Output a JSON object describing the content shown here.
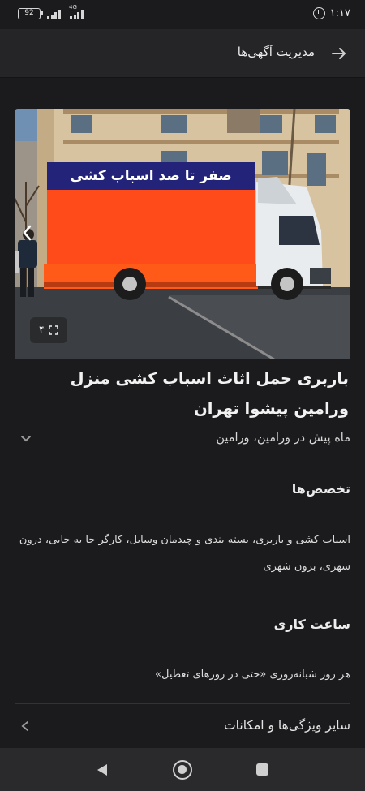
{
  "status_bar": {
    "battery": "92",
    "network": "4G",
    "time": "۱:۱۷",
    "icons": [
      "battery-icon",
      "signal-icon",
      "alarm-icon"
    ]
  },
  "header": {
    "title": "مدیریت آگهی‌ها",
    "back_icon": "arrow-right-icon"
  },
  "listing": {
    "image": {
      "banner_text": "صفر تا صد اسباب کشی",
      "photo_count": "۴",
      "count_icon": "expand-icon",
      "prev_icon": "chevron-left-icon"
    },
    "title": "باربری حمل اثاث اسباب کشی منزل ورامین پیشوا تهران",
    "meta": "ماه پیش در ورامین، ورامین",
    "meta_icon": "chevron-down-icon"
  },
  "specialties": {
    "title": "تخصص‌ها",
    "body": "اسباب کشی و باربری، بسته بندی و چیدمان وسایل، کارگر جا به جایی، درون شهری، برون شهری"
  },
  "working_hours": {
    "title": "ساعت کاری",
    "body": "هر روز شبانه‌روزی «حتی در روزهای تعطیل»"
  },
  "features": {
    "label": "سایر ویژگی‌ها و امکانات",
    "icon": "chevron-left-icon"
  },
  "navigation": {
    "icons": [
      "nav-back-icon",
      "nav-home-icon",
      "nav-recent-icon"
    ]
  },
  "colors": {
    "background": "#1b1b1d",
    "appbar": "#252528",
    "truck_box": "#ff4a1a",
    "banner": "#23237a"
  }
}
